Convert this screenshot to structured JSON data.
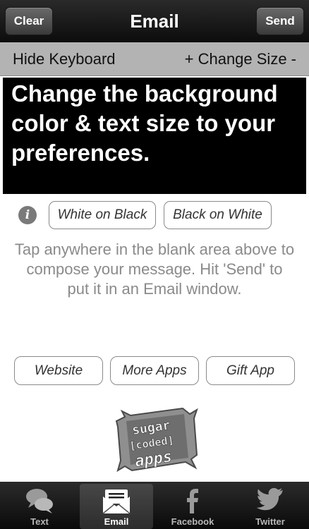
{
  "navbar": {
    "title": "Email",
    "clear_label": "Clear",
    "send_label": "Send"
  },
  "toolbar": {
    "hide_keyboard": "Hide Keyboard",
    "change_size": "+ Change Size -"
  },
  "compose": {
    "text": "Change the background color & text size to your preferences."
  },
  "color_options": {
    "white_on_black": "White on Black",
    "black_on_white": "Black on White"
  },
  "hint": "Tap anywhere in the blank area above to compose your message. Hit 'Send' to put it in an Email window.",
  "links": {
    "website": "Website",
    "more_apps": "More Apps",
    "gift_app": "Gift App"
  },
  "logo": {
    "line1": "sugar",
    "line2": "[coded]",
    "line3": "apps"
  },
  "tabs": [
    {
      "label": "Text",
      "icon": "speech-bubbles-icon"
    },
    {
      "label": "Email",
      "icon": "envelope-icon"
    },
    {
      "label": "Facebook",
      "icon": "facebook-icon"
    },
    {
      "label": "Twitter",
      "icon": "twitter-bird-icon"
    }
  ],
  "selected_tab": "Email",
  "colors": {
    "navbar": "#111111",
    "toolbar": "#b3b3b3",
    "compose_background": "#000000",
    "compose_text": "#ffffff",
    "hint_text": "#8a8a8a"
  }
}
